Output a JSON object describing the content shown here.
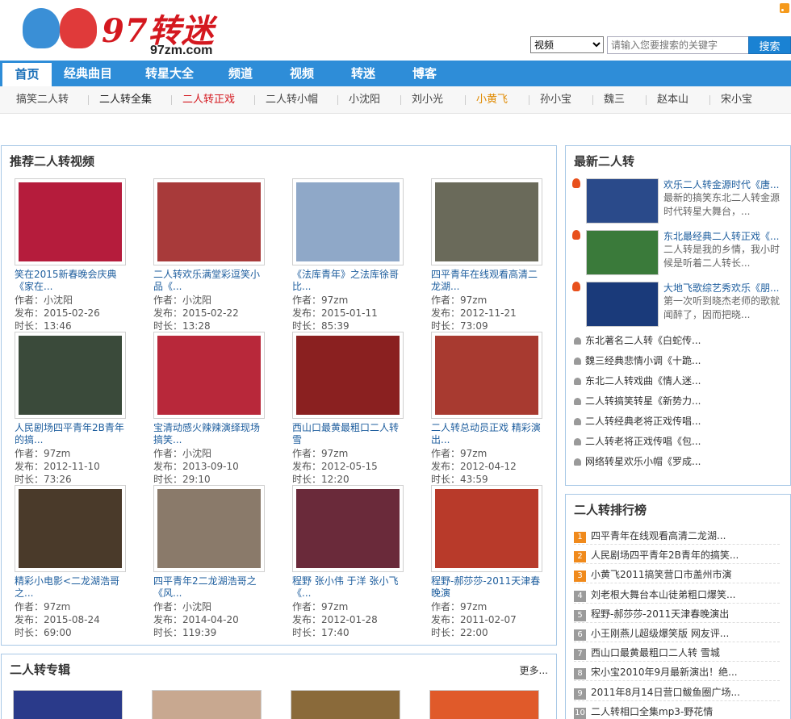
{
  "site": {
    "brand": "97转迷",
    "domain": "97zm.com"
  },
  "search": {
    "category": "视频",
    "placeholder": "请输入您要搜索的关键字",
    "button": "搜索"
  },
  "nav": [
    "首页",
    "经典曲目",
    "转星大全",
    "频道",
    "视频",
    "转迷",
    "博客"
  ],
  "subnav": [
    {
      "label": "搞笑二人转",
      "color": "#444444"
    },
    {
      "label": "二人转全集",
      "color": "#222222"
    },
    {
      "label": "二人转正戏",
      "color": "#d4181f"
    },
    {
      "label": "二人转小帽",
      "color": "#444444"
    },
    {
      "label": "小沈阳",
      "color": "#444444"
    },
    {
      "label": "刘小光",
      "color": "#444444"
    },
    {
      "label": "小黄飞",
      "color": "#e08a00"
    },
    {
      "label": "孙小宝",
      "color": "#444444"
    },
    {
      "label": "魏三",
      "color": "#444444"
    },
    {
      "label": "赵本山",
      "color": "#444444"
    },
    {
      "label": "宋小宝",
      "color": "#444444"
    }
  ],
  "recommend": {
    "title": "推荐二人转视频",
    "author_label": "作者：",
    "date_label": "发布：",
    "duration_label": "时长：",
    "videos": [
      {
        "title": "笑在2015新春晚会庆典《家在...",
        "author": "小沈阳",
        "date": "2015-02-26",
        "duration": "13:46",
        "color": "#b51c3c"
      },
      {
        "title": "二人转欢乐满堂彩逗笑小品《...",
        "author": "小沈阳",
        "date": "2015-02-22",
        "duration": "13:28",
        "color": "#a83a3a"
      },
      {
        "title": "《法库青年》之法库徐哥比...",
        "author": "97zm",
        "date": "2015-01-11",
        "duration": "85:39",
        "color": "#8fa8c8"
      },
      {
        "title": "四平青年在线观看高清二龙湖...",
        "author": "97zm",
        "date": "2012-11-21",
        "duration": "73:09",
        "color": "#6a6a5a"
      },
      {
        "title": "人民剧场四平青年2B青年的搞...",
        "author": "97zm",
        "date": "2012-11-10",
        "duration": "73:26",
        "color": "#3a4a3a"
      },
      {
        "title": "宝清动感火辣辣演绎现场搞笑...",
        "author": "小沈阳",
        "date": "2013-09-10",
        "duration": "29:10",
        "color": "#b8283a"
      },
      {
        "title": "西山口最黄最粗口二人转雪",
        "author": "97zm",
        "date": "2012-05-15",
        "duration": "12:20",
        "color": "#8a2020"
      },
      {
        "title": "二人转总动员正戏 精彩演出...",
        "author": "97zm",
        "date": "2012-04-12",
        "duration": "43:59",
        "color": "#a83a30"
      },
      {
        "title": "精彩小电影<二龙湖浩哥之...",
        "author": "97zm",
        "date": "2015-08-24",
        "duration": "69:00",
        "color": "#4a3a2a"
      },
      {
        "title": "四平青年2二龙湖浩哥之《风...",
        "author": "小沈阳",
        "date": "2014-04-20",
        "duration": "119:39",
        "color": "#8a7a6a"
      },
      {
        "title": "程野 张小伟 于洋 张小飞《...",
        "author": "97zm",
        "date": "2012-01-28",
        "duration": "17:40",
        "color": "#6a2a3a"
      },
      {
        "title": "程野-郝莎莎-2011天津春晚演",
        "author": "97zm",
        "date": "2011-02-07",
        "duration": "22:00",
        "color": "#b83a2a"
      }
    ]
  },
  "album": {
    "title": "二人转专辑",
    "more": "更多..."
  },
  "latest": {
    "title": "最新二人转",
    "featured": [
      {
        "title": "欢乐二人转金源时代《唐...",
        "desc": "最新的搞笑东北二人转金源时代转星大舞台，...",
        "color": "#2a4a8a"
      },
      {
        "title": "东北最经典二人转正戏《...",
        "desc": "二人转是我的乡情，我小时候是听着二人转长...",
        "color": "#3a7a3a"
      },
      {
        "title": "大地飞歌综艺秀欢乐《朋...",
        "desc": "第一次听到晓杰老师的歌就闻醉了，因而把晓...",
        "color": "#1a3a7a"
      }
    ],
    "links": [
      "东北著名二人转《白蛇传...",
      "魏三经典悲情小调《十跪...",
      "东北二人转戏曲《情人迷...",
      "二人转搞笑转星《新势力...",
      "二人转经典老将正戏传唱...",
      "二人转老将正戏传唱《包...",
      "网络转星欢乐小帽《罗成..."
    ]
  },
  "ranking": {
    "title": "二人转排行榜",
    "items": [
      {
        "rank": "1",
        "text": "四平青年在线观看高清二龙湖..."
      },
      {
        "rank": "2",
        "text": "人民剧场四平青年2B青年的搞笑..."
      },
      {
        "rank": "3",
        "text": "小黄飞2011搞笑营口市盖州市演"
      },
      {
        "rank": "4",
        "text": "刘老根大舞台本山徒弟粗口爆笑..."
      },
      {
        "rank": "5",
        "text": "程野-郝莎莎-2011天津春晚演出"
      },
      {
        "rank": "6",
        "text": "小王刚燕儿超级爆笑版 网友评..."
      },
      {
        "rank": "7",
        "text": "西山口最黄最粗口二人转 雪城"
      },
      {
        "rank": "8",
        "text": "宋小宝2010年9月最新演出！绝..."
      },
      {
        "rank": "9",
        "text": "2011年8月14日营口鲅鱼圈广场..."
      },
      {
        "rank": "10",
        "text": "二人转相口全集mp3-野花情"
      }
    ]
  }
}
